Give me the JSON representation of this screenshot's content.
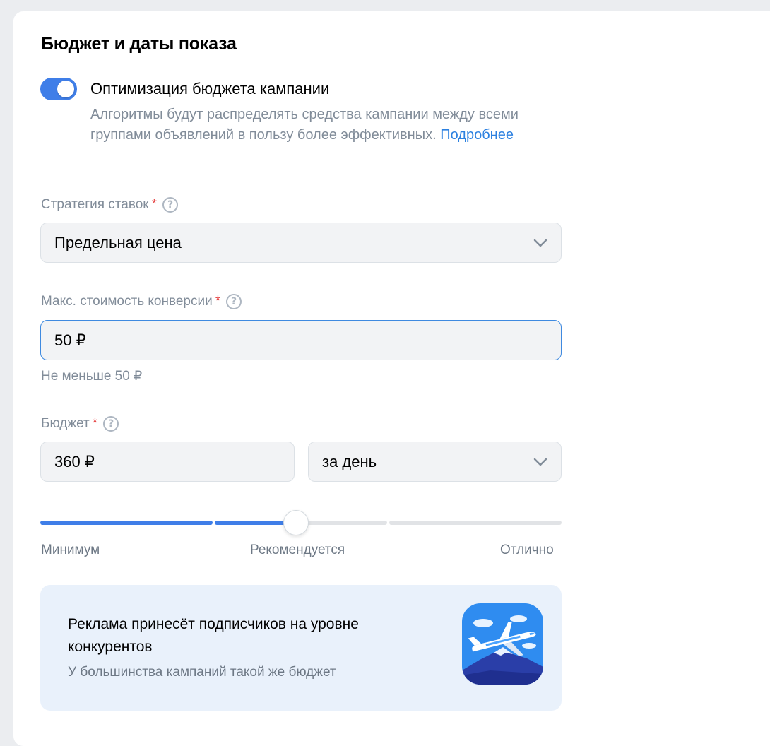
{
  "section": {
    "title": "Бюджет и даты показа"
  },
  "optimization": {
    "enabled": true,
    "title": "Оптимизация бюджета кампании",
    "description": "Алгоритмы будут распределять средства кампании между всеми группами объявлений в пользу более эффективных.",
    "link": "Подробнее"
  },
  "strategy": {
    "label": "Стратегия ставок",
    "required_mark": "*",
    "help_icon": "?",
    "value": "Предельная цена"
  },
  "max_cost": {
    "label": "Макс. стоимость конверсии",
    "required_mark": "*",
    "help_icon": "?",
    "value": "50 ₽",
    "hint": "Не меньше 50 ₽"
  },
  "budget": {
    "label": "Бюджет",
    "required_mark": "*",
    "help_icon": "?",
    "amount": "360 ₽",
    "period": "за день"
  },
  "budget_slider": {
    "level_fraction": 0.49,
    "labels": {
      "min": "Минимум",
      "recommended": "Рекомендуется",
      "excellent": "Отлично"
    }
  },
  "promo": {
    "title": "Реклама принесёт подписчиков на уровне конкурентов",
    "subtitle": "У большинства кампаний такой же бюджет",
    "image_icon": "airplane-icon"
  },
  "colors": {
    "accent": "#3f7ee8",
    "link": "#2d81e0",
    "required": "#e64646",
    "secondary_text": "#818c99",
    "promo_bg": "#e9f1fb",
    "input_bg": "#f2f3f5",
    "focus_border": "#3f8ae0"
  }
}
